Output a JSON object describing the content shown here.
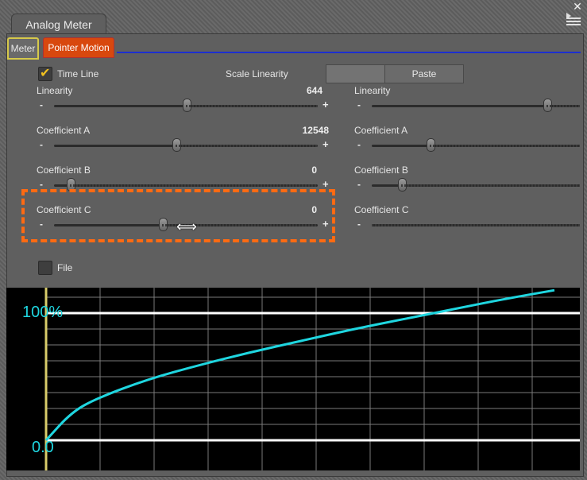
{
  "window": {
    "title": "Analog Meter"
  },
  "tabs": {
    "meter": "Meter",
    "pointer_motion": "Pointer Motion"
  },
  "left": {
    "time_line": {
      "label": "Time Line",
      "checked": true
    },
    "scale_linearity": "Scale Linearity",
    "paste": "Paste",
    "linearity": {
      "label": "Linearity",
      "value": "644",
      "position": 0.5
    },
    "coef_a": {
      "label": "Coefficient A",
      "value": "12548",
      "position": 0.46
    },
    "coef_b": {
      "label": "Coefficient B",
      "value": "0",
      "position": 0.06
    },
    "coef_c": {
      "label": "Coefficient C",
      "value": "0",
      "position": 0.41
    }
  },
  "right": {
    "linearity": {
      "label": "Linearity",
      "position": 0.84
    },
    "coef_a": {
      "label": "Coefficient A",
      "position": 0.28
    },
    "coef_b": {
      "label": "Coefficient B",
      "position": 0.14
    },
    "coef_c": {
      "label": "Coefficient C",
      "position": 0.0
    }
  },
  "file": {
    "label": "File",
    "checked": false
  },
  "chart_data": {
    "type": "line",
    "labels": {
      "top": "100%",
      "bottom": "0.0"
    },
    "series": [
      {
        "color": "#1fd6e0",
        "x": [
          0,
          0.05,
          0.1,
          0.2,
          0.3,
          0.4,
          0.5,
          0.6,
          0.7,
          0.8,
          0.9,
          1.0
        ],
        "y": [
          0,
          0.22,
          0.33,
          0.48,
          0.59,
          0.69,
          0.78,
          0.87,
          0.95,
          1.03,
          1.11,
          1.18
        ]
      }
    ],
    "xlim": [
      0,
      1
    ],
    "ylim": [
      0,
      1
    ],
    "grid": true
  }
}
